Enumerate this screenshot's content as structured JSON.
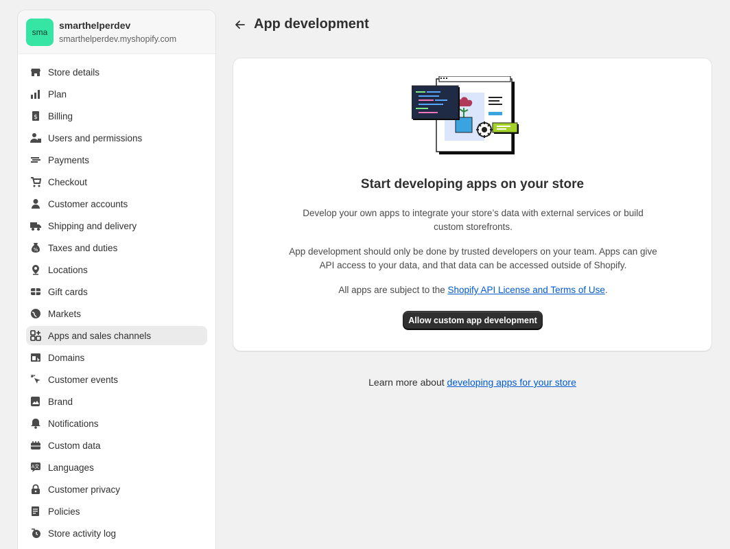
{
  "store": {
    "avatar_initials": "sma",
    "name": "smarthelperdev",
    "domain": "smarthelperdev.myshopify.com",
    "avatar_color": "#36e5a4"
  },
  "sidebar": {
    "items": [
      {
        "label": "Store details",
        "icon": "store-icon"
      },
      {
        "label": "Plan",
        "icon": "plan-icon"
      },
      {
        "label": "Billing",
        "icon": "billing-icon"
      },
      {
        "label": "Users and permissions",
        "icon": "users-icon"
      },
      {
        "label": "Payments",
        "icon": "payments-icon"
      },
      {
        "label": "Checkout",
        "icon": "cart-icon"
      },
      {
        "label": "Customer accounts",
        "icon": "person-icon"
      },
      {
        "label": "Shipping and delivery",
        "icon": "truck-icon"
      },
      {
        "label": "Taxes and duties",
        "icon": "tax-icon"
      },
      {
        "label": "Locations",
        "icon": "location-icon"
      },
      {
        "label": "Gift cards",
        "icon": "gift-card-icon"
      },
      {
        "label": "Markets",
        "icon": "globe-icon"
      },
      {
        "label": "Apps and sales channels",
        "icon": "apps-icon",
        "active": true
      },
      {
        "label": "Domains",
        "icon": "domain-icon"
      },
      {
        "label": "Customer events",
        "icon": "cursor-click-icon"
      },
      {
        "label": "Brand",
        "icon": "brand-icon"
      },
      {
        "label": "Notifications",
        "icon": "bell-icon"
      },
      {
        "label": "Custom data",
        "icon": "database-icon"
      },
      {
        "label": "Languages",
        "icon": "language-icon"
      },
      {
        "label": "Customer privacy",
        "icon": "lock-icon"
      },
      {
        "label": "Policies",
        "icon": "policy-icon"
      },
      {
        "label": "Store activity log",
        "icon": "activity-log-icon"
      }
    ]
  },
  "page": {
    "title": "App development"
  },
  "card": {
    "heading": "Start developing apps on your store",
    "paragraph1": "Develop your own apps to integrate your store’s data with external services or build custom storefronts.",
    "paragraph2": "App development should only be done by trusted developers on your team. Apps can give API access to your data, and that data can be accessed outside of Shopify.",
    "paragraph3_prefix": "All apps are subject to the ",
    "paragraph3_link": "Shopify API License and Terms of Use",
    "paragraph3_suffix": ".",
    "button_label": "Allow custom app development"
  },
  "footer": {
    "prefix": "Learn more about ",
    "link": "developing apps for your store"
  },
  "colors": {
    "link": "#005bd3",
    "primary_button": "#303030",
    "active_nav": "#ebebeb"
  }
}
